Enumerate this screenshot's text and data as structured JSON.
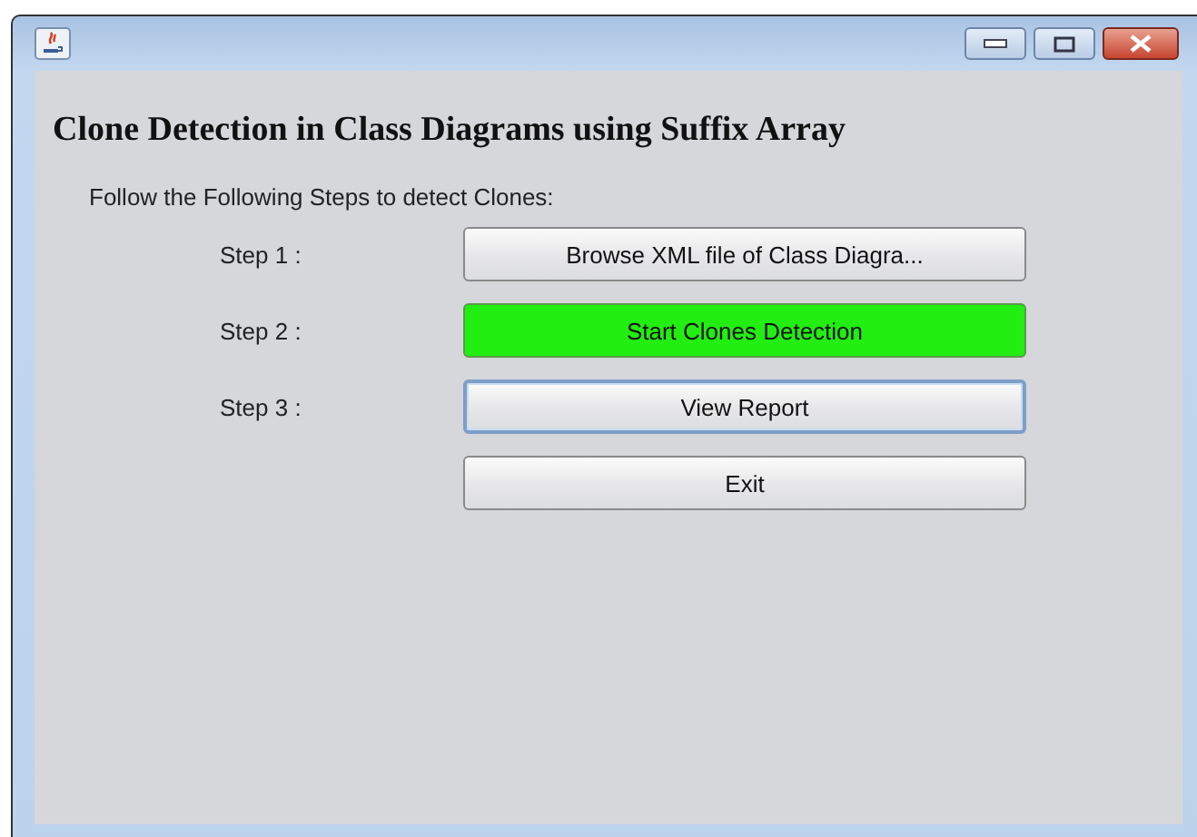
{
  "heading": "Clone Detection in Class Diagrams using Suffix Array",
  "instruction": "Follow the Following Steps to detect Clones:",
  "steps": [
    {
      "label": "Step 1 :",
      "button": {
        "text": "Browse XML file of Class Diagra...",
        "highlighted": false,
        "focused": false
      }
    },
    {
      "label": "Step 2 :",
      "button": {
        "text": "Start Clones Detection",
        "highlighted": true,
        "focused": false
      }
    },
    {
      "label": "Step 3 :",
      "button": {
        "text": "View Report",
        "highlighted": false,
        "focused": true
      }
    },
    {
      "button": {
        "text": "Exit",
        "highlighted": false,
        "focused": false
      }
    }
  ]
}
